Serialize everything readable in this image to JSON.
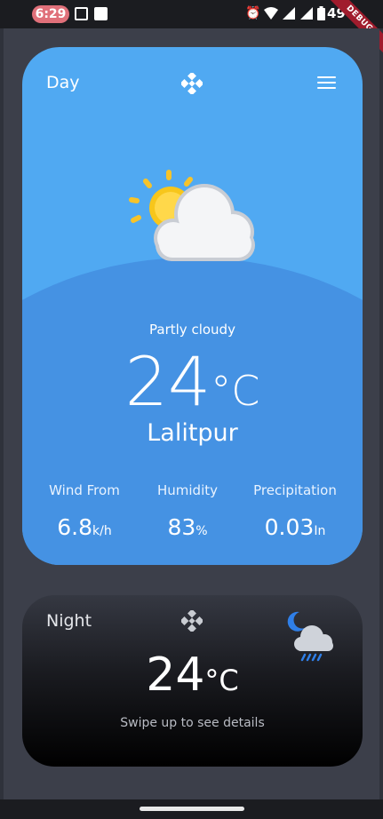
{
  "status_bar": {
    "time": "6:29",
    "battery": "49%",
    "debug_banner": "DEBUG"
  },
  "day_card": {
    "title": "Day",
    "condition": "Partly cloudy",
    "temperature": "24",
    "temperature_unit": "°C",
    "city": "Lalitpur",
    "stats": [
      {
        "label": "Wind From",
        "value": "6.8",
        "unit": "k/h"
      },
      {
        "label": "Humidity",
        "value": "83",
        "unit": "%"
      },
      {
        "label": "Precipitation",
        "value": "0.03",
        "unit": "In"
      }
    ],
    "weather_icon": "partly-cloudy-sun-icon"
  },
  "night_card": {
    "title": "Night",
    "temperature": "24",
    "temperature_unit": "°C",
    "hint": "Swipe up to see details",
    "weather_icon": "night-rain-cloud-icon"
  },
  "colors": {
    "day_card_bg": "#50a9f2",
    "day_hill": "#4592e3",
    "app_bg": "#3c3f4a"
  }
}
